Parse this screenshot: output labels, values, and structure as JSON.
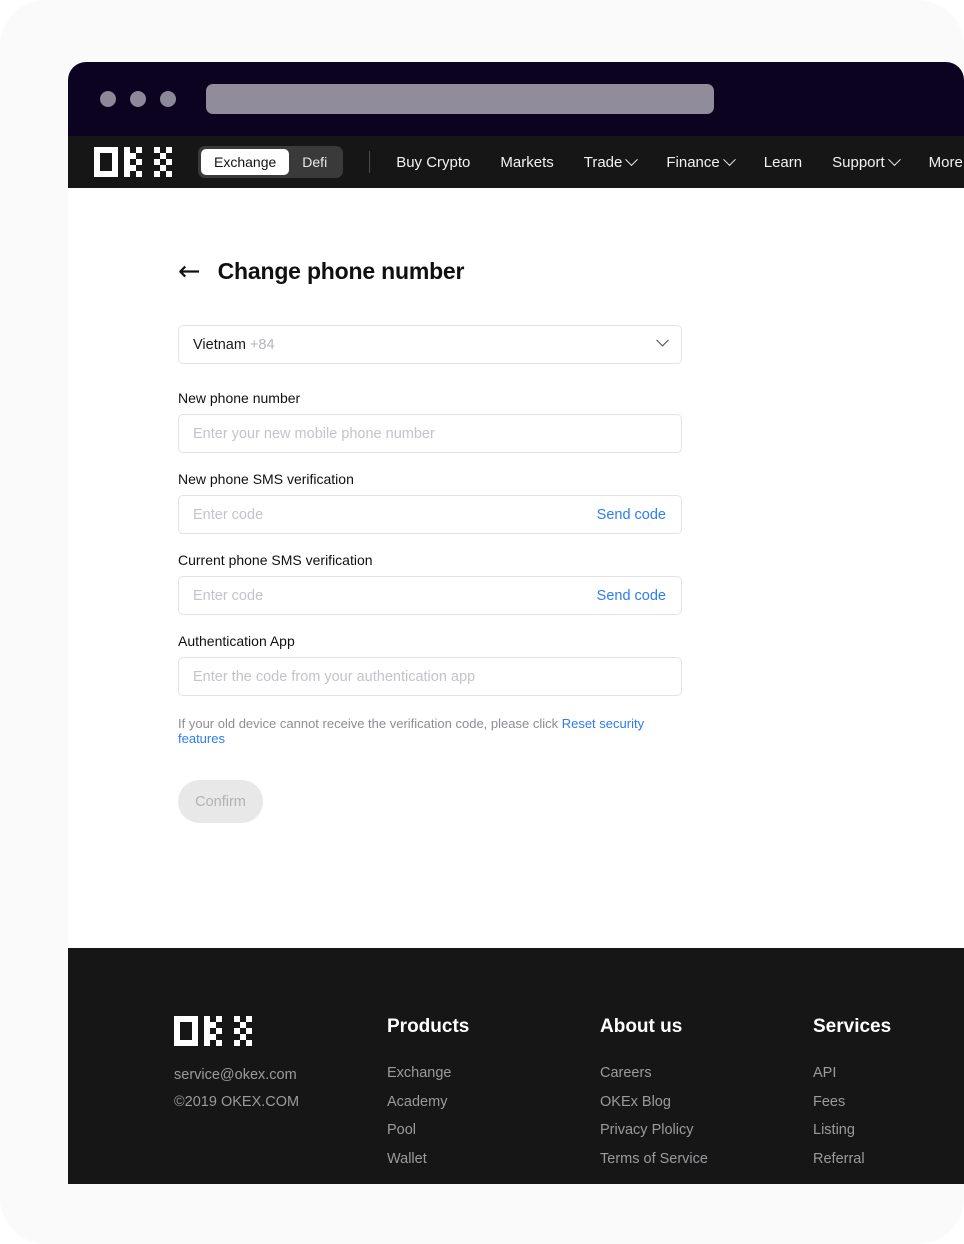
{
  "browser": {
    "dots": [
      "dot-1",
      "dot-2",
      "dot-3"
    ],
    "address_bar_value": ""
  },
  "nav": {
    "logo_alt": "OKX",
    "mode_toggle": {
      "options": [
        "Exchange",
        "Defi"
      ],
      "selected": "Exchange"
    },
    "links": [
      {
        "label": "Buy Crypto",
        "has_caret": false
      },
      {
        "label": "Markets",
        "has_caret": false
      },
      {
        "label": "Trade",
        "has_caret": true
      },
      {
        "label": "Finance",
        "has_caret": true
      },
      {
        "label": "Learn",
        "has_caret": false
      },
      {
        "label": "Support",
        "has_caret": true
      },
      {
        "label": "More",
        "has_caret": true
      }
    ]
  },
  "main": {
    "back_arrow": "←",
    "title": "Change phone number",
    "country": {
      "name": "Vietnam",
      "dial_code": "+84"
    },
    "fields": [
      {
        "label": "New phone number",
        "placeholder": "Enter your new mobile phone number",
        "value": "",
        "action": null
      },
      {
        "label": "New phone SMS verification",
        "placeholder": "Enter code",
        "value": "",
        "action": "Send code"
      },
      {
        "label": "Current phone SMS verification",
        "placeholder": "Enter code",
        "value": "",
        "action": "Send code"
      },
      {
        "label": "Authentication App",
        "placeholder": "Enter the code from your authentication app",
        "value": "",
        "action": null
      }
    ],
    "helper_text_before": "If your old device cannot receive the verification code, please click ",
    "helper_link": "Reset security features",
    "confirm_label": "Confirm"
  },
  "footer": {
    "email": "service@okex.com",
    "copyright": "©2019 OKEX.COM",
    "columns": [
      {
        "title": "Products",
        "items": [
          "Exchange",
          "Academy",
          "Pool",
          "Wallet"
        ]
      },
      {
        "title": "About us",
        "items": [
          "Careers",
          "OKEx Blog",
          "Privacy Plolicy",
          "Terms of Service"
        ]
      },
      {
        "title": "Services",
        "items": [
          "API",
          "Fees",
          "Listing",
          "Referral"
        ]
      }
    ]
  },
  "colors": {
    "accent_blue": "#2b7cf7",
    "nav_bg": "#161616",
    "chrome_bg": "#0c0320",
    "page_bg": "#ffffff",
    "disabled_btn": "#e8e8e8"
  }
}
